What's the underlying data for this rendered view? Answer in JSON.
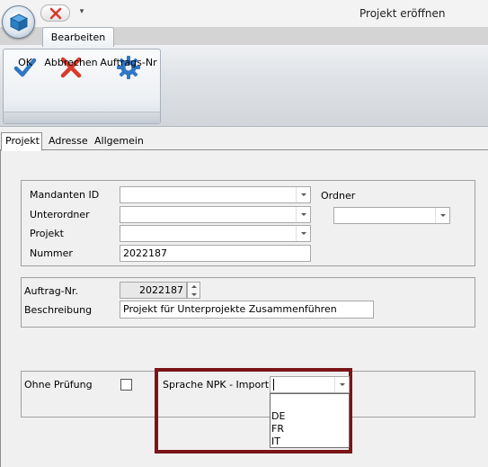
{
  "window": {
    "title": "Projekt eröffnen",
    "qat_dropdown_glyph": "▾"
  },
  "ribbon": {
    "tab": "Bearbeiten",
    "buttons": [
      {
        "label": "OK",
        "icon": "checkmark-icon",
        "color": "#2f76c5"
      },
      {
        "label": "Abbrechen",
        "icon": "close-x-icon",
        "color": "#d83b2a"
      },
      {
        "label": "Auftrags-Nr",
        "icon": "gear-icon",
        "color": "#2f76c5"
      }
    ]
  },
  "tabs": [
    {
      "label": "Projekt",
      "active": true
    },
    {
      "label": "Adresse",
      "active": false
    },
    {
      "label": "Allgemein",
      "active": false
    }
  ],
  "projekt_group": {
    "mandanten_label": "Mandanten ID",
    "mandanten_value": "",
    "unterordner_label": "Unterordner",
    "unterordner_value": "",
    "projekt_label": "Projekt",
    "projekt_value": "",
    "nummer_label": "Nummer",
    "nummer_value": "2022187",
    "ordner_label": "Ordner",
    "ordner_value": ""
  },
  "auftrag_group": {
    "auftrag_label": "Auftrag-Nr.",
    "auftrag_value": "2022187",
    "beschreibung_label": "Beschreibung",
    "beschreibung_value": "Projekt für Unterprojekte Zusammenführen"
  },
  "sprache_group": {
    "ohne_pruefung_label": "Ohne Prüfung",
    "ohne_pruefung_checked": false,
    "sprache_label": "Sprache NPK - Import",
    "sprache_value": "",
    "options": [
      "DE",
      "FR",
      "IT"
    ]
  },
  "colors": {
    "highlight_border": "#7a1416",
    "accent_blue": "#2f76c5",
    "cancel_red": "#d83b2a"
  }
}
